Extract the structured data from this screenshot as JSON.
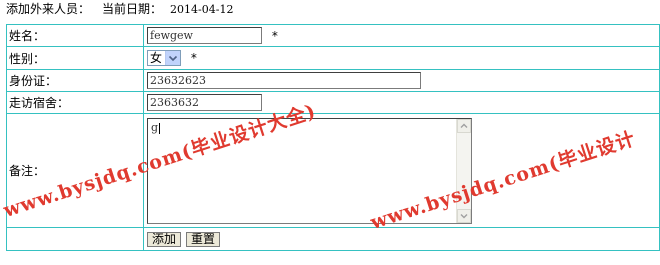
{
  "header": {
    "title": "添加外来人员：",
    "date_label": "当前日期：",
    "date_value": "2014-04-12"
  },
  "form": {
    "name": {
      "label": "姓名：",
      "value": "fewgew",
      "required_mark": "*"
    },
    "gender": {
      "label": "性别：",
      "selected": "女",
      "required_mark": "*"
    },
    "id_card": {
      "label": "身份证：",
      "value": "23632623"
    },
    "dorm": {
      "label": "走访宿舍：",
      "value": "2363632"
    },
    "remark": {
      "label": "备注：",
      "value": "g"
    }
  },
  "buttons": {
    "add": "添加",
    "reset": "重置"
  },
  "watermarks": {
    "left": "www.bysjdq.com(毕业设计大全)",
    "right": "www.bysjdq.com(毕业设计"
  },
  "colors": {
    "table_border": "#35c1c1",
    "watermark": "#e03a2f"
  }
}
